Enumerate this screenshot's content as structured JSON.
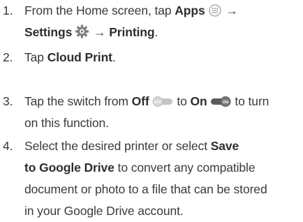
{
  "steps": [
    {
      "number": "1.",
      "lines": [
        [
          {
            "t": "From the Home screen, tap "
          },
          {
            "t": "Apps",
            "b": true
          },
          {
            "icon": "apps-icon"
          },
          {
            "t": " → "
          }
        ],
        [
          {
            "t": "Settings",
            "b": true
          },
          {
            "icon": "settings-gear-icon"
          },
          {
            "t": " → "
          },
          {
            "t": "Printing",
            "b": true
          },
          {
            "t": "."
          }
        ]
      ]
    },
    {
      "number": "2.",
      "lines": [
        [
          {
            "t": "Tap "
          },
          {
            "t": "Cloud Print",
            "b": true
          },
          {
            "t": "."
          }
        ]
      ]
    },
    {
      "number": "3.",
      "lines": [
        [
          {
            "t": "Tap the switch from "
          },
          {
            "t": "Off",
            "b": true
          },
          {
            "icon": "switch-off-icon"
          },
          {
            "t": " to "
          },
          {
            "t": "On",
            "b": true
          },
          {
            "icon": "switch-on-icon"
          },
          {
            "t": " to turn"
          }
        ],
        [
          {
            "t": "on this function."
          }
        ]
      ]
    },
    {
      "number": "4.",
      "lines": [
        [
          {
            "t": "Select the desired printer or select "
          },
          {
            "t": "Save",
            "b": true
          }
        ],
        [
          {
            "t": "to Google Drive",
            "b": true
          },
          {
            "t": " to convert any compatible"
          }
        ],
        [
          {
            "t": "document or photo to a file that can be stored"
          }
        ],
        [
          {
            "t": "in your Google Drive account."
          }
        ]
      ]
    }
  ],
  "icons": {
    "switch_off_text": "OFF",
    "switch_on_text": "ON",
    "switch_off_color": "#c4c4c4",
    "switch_on_color": "#5b5b5b",
    "gear_color": "#7f7f7f"
  }
}
